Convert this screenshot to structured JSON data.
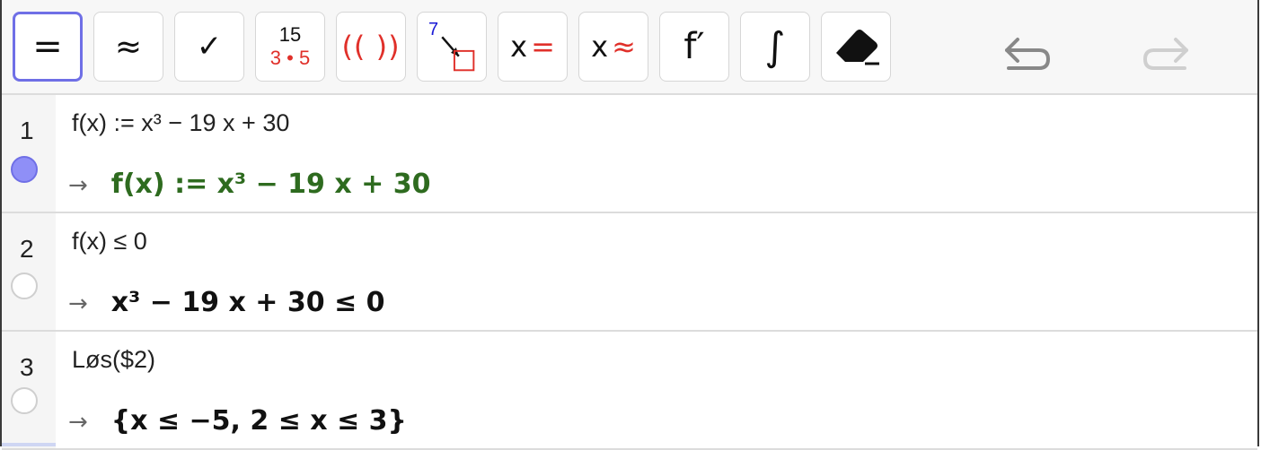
{
  "toolbar": {
    "evaluate_label": "=",
    "numeric_label": "≈",
    "keep_input_label": "✓",
    "factor_top": "15",
    "factor_bottom": "3 • 5",
    "expand_label": "(( ))",
    "substitute_sup": "7",
    "solve_label": "x",
    "solve_sym": "=",
    "nsolve_label": "x",
    "nsolve_sym": "≈",
    "derivative_label": "f′",
    "integral_label": "∫",
    "icons": {
      "eraser": "eraser-icon",
      "undo": "undo-icon",
      "redo": "redo-icon"
    }
  },
  "rows": [
    {
      "number": "1",
      "input": "f(x) := x³ − 19 x + 30",
      "output": "f(x) := x³ − 19 x + 30",
      "output_color": "#2e6b1f",
      "active": true
    },
    {
      "number": "2",
      "input": "f(x) ≤ 0",
      "output": "x³ − 19 x + 30 ≤ 0",
      "output_color": "#111111",
      "active": false
    },
    {
      "number": "3",
      "input": "Løs($2)",
      "output": "{x ≤ −5, 2 ≤ x ≤ 3}",
      "output_color": "#111111",
      "active": false
    }
  ],
  "arrow": "→",
  "colors": {
    "accent": "#6f6fe6",
    "red": "#e0302a",
    "blue": "#1a1ad6"
  }
}
